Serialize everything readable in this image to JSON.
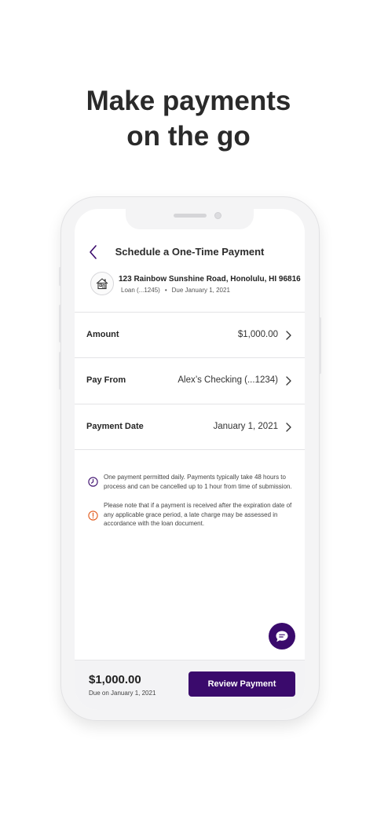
{
  "marketing": {
    "headline_line1": "Make payments",
    "headline_line2": "on the go"
  },
  "screen": {
    "title": "Schedule a One-Time Payment",
    "property": {
      "address": "123 Rainbow Sunshine Road, Honolulu, HI 96816",
      "loan": "Loan (...1245)",
      "separator": "•",
      "due": "Due January 1, 2021",
      "icon": "house-icon"
    },
    "rows": [
      {
        "label": "Amount",
        "value": "$1,000.00"
      },
      {
        "label": "Pay From",
        "value": "Alex’s Checking (...1234)"
      },
      {
        "label": "Payment Date",
        "value": "January 1, 2021"
      }
    ],
    "notes": [
      {
        "icon": "clock-icon",
        "text": "One payment permitted daily. Payments typically take 48 hours to process and can be cancelled up to 1 hour from time of submission."
      },
      {
        "icon": "warning-icon",
        "text": "Please note that if a payment is received after the expiration date of any applicable grace period, a late charge may be assessed in accordance with the loan document."
      }
    ],
    "footer": {
      "total": "$1,000.00",
      "due": "Due on January 1, 2021",
      "button_label": "Review Payment"
    }
  },
  "colors": {
    "brand_purple": "#3a0a6c",
    "clock_accent": "#3a0a6c",
    "warning_accent": "#e25a1c"
  }
}
